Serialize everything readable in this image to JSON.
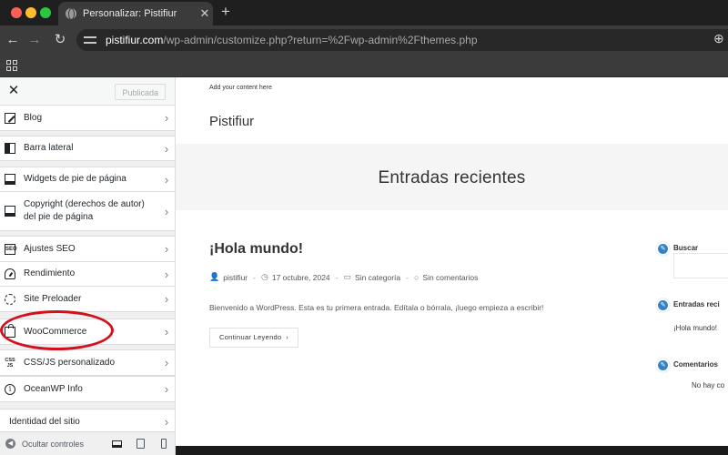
{
  "browser": {
    "tab_title": "Personalizar: Pistifiur",
    "url_host": "pistifiur.com",
    "url_path": "/wp-admin/customize.php?return=%2Fwp-admin%2Fthemes.php"
  },
  "customizer": {
    "publish_label": "Publicada",
    "items": [
      {
        "label": "Blog",
        "icon": "edit-icon"
      },
      {
        "label": "Barra lateral",
        "icon": "sidebar-icon"
      },
      {
        "label": "Widgets de pie de página",
        "icon": "footer-widgets-icon"
      },
      {
        "label": "Copyright (derechos de autor) del pie de página",
        "icon": "footer-bottom-icon"
      },
      {
        "label": "Ajustes SEO",
        "icon": "seo-icon"
      },
      {
        "label": "Rendimiento",
        "icon": "performance-icon"
      },
      {
        "label": "Site Preloader",
        "icon": "preloader-icon"
      },
      {
        "label": "WooCommerce",
        "icon": "shopping-bag-icon"
      },
      {
        "label": "CSS/JS personalizado",
        "icon": "css-js-icon"
      },
      {
        "label": "OceanWP Info",
        "icon": "info-icon"
      }
    ],
    "site_identity_label": "Identidad del sitio",
    "hide_controls_label": "Ocultar controles"
  },
  "preview": {
    "topbar_text": "Add your content here",
    "site_title": "Pistifiur",
    "page_title": "Entradas recientes",
    "post": {
      "title": "¡Hola mundo!",
      "author": "pistifiur",
      "date": "17 octubre, 2024",
      "category": "Sin categoría",
      "comments": "Sin comentarios",
      "excerpt": "Bienvenido a WordPress. Esta es tu primera entrada. Edítala o bórrala, ¡luego empieza a escribir!",
      "read_more": "Continuar Leyendo"
    },
    "widgets": {
      "search_title": "Buscar",
      "recent_title": "Entradas reci",
      "recent_item": "¡Hola mundo!",
      "comments_title": "Comentarios",
      "comments_item": "No hay co"
    }
  },
  "colors": {
    "highlight": "#d3111d",
    "edit_shortcut": "#3582c4"
  }
}
